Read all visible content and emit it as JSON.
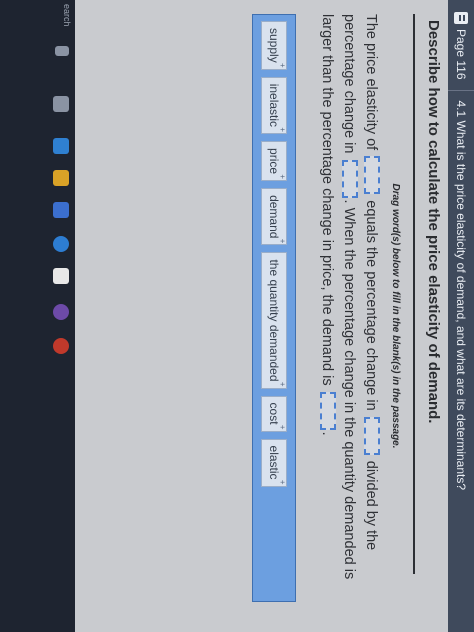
{
  "topbar": {
    "page_label": "Page 116",
    "question": "4.1 What is the price elasticity of demand, and what are its determinants?"
  },
  "heading": "Describe how to calculate the price elasticity of demand.",
  "instruction": "Drag word(s) below to fill in the blank(s) in the passage.",
  "passage": {
    "p1": "The price elasticity of",
    "p2": "equals the percentage change in",
    "p3": "divided by the percentage change in",
    "p4": ". When the percentage change in the quantity demanded is larger than the percentage change in price, the demand is",
    "p5": "."
  },
  "word_bank": [
    {
      "label": "supply",
      "plus": "+"
    },
    {
      "label": "inelastic",
      "plus": "+"
    },
    {
      "label": "price",
      "plus": "+"
    },
    {
      "label": "demand",
      "plus": "+"
    },
    {
      "label": "the quantity demanded",
      "plus": "+"
    },
    {
      "label": "cost",
      "plus": "+"
    },
    {
      "label": "elastic",
      "plus": "+"
    }
  ],
  "taskbar": {
    "search_label": "earch"
  },
  "colors": {
    "topbar": "#3f4a5c",
    "bank": "#6c9fe0",
    "blank_border": "#4a7fd1"
  }
}
